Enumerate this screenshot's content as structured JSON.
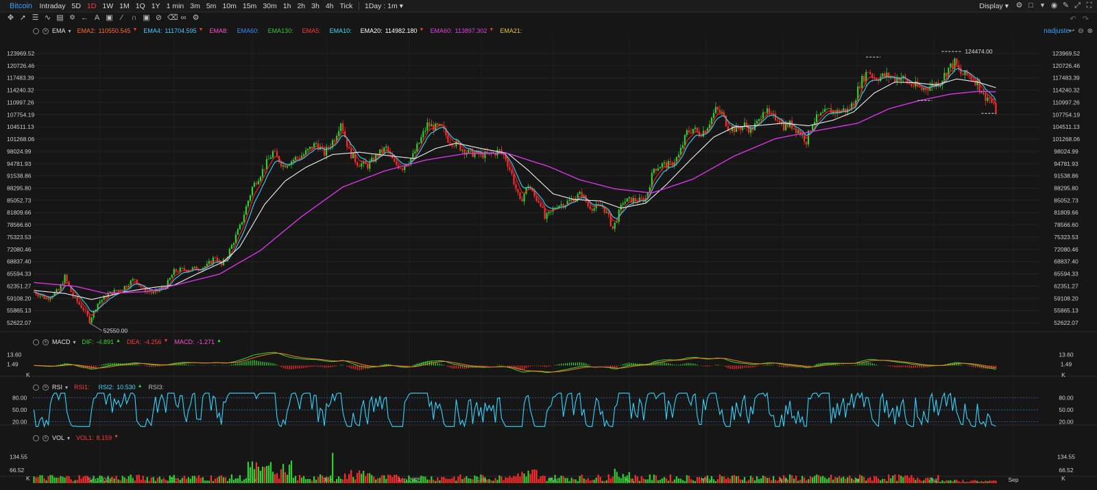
{
  "topbar": {
    "symbol": "Bitcoin",
    "timeframes": [
      "Intraday",
      "5D",
      "1D",
      "1W",
      "1M",
      "1Q",
      "1Y",
      "1 min",
      "3m",
      "5m",
      "10m",
      "15m",
      "30m",
      "1h",
      "2h",
      "3h",
      "4h",
      "Tick"
    ],
    "active_timeframe": "1D",
    "interval_select": "1Day : 1m",
    "display_label": "Display"
  },
  "main_legend": {
    "name": "EMA",
    "items": [
      {
        "label": "EMA2:",
        "value": "110550.545",
        "color": "#ff6a3a",
        "arrow": "down"
      },
      {
        "label": "EMA4:",
        "value": "111704.595",
        "color": "#46c8ff",
        "arrow": "down"
      },
      {
        "label": "EMA8:",
        "value": "",
        "color": "#ff4fcf",
        "arrow": ""
      },
      {
        "label": "EMA60:",
        "value": "",
        "color": "#3a8cff",
        "arrow": ""
      },
      {
        "label": "EMA130:",
        "value": "",
        "color": "#39c639",
        "arrow": ""
      },
      {
        "label": "EMA5:",
        "value": "",
        "color": "#ff3a3a",
        "arrow": ""
      },
      {
        "label": "EMA10:",
        "value": "",
        "color": "#46d8ff",
        "arrow": ""
      },
      {
        "label": "EMA20:",
        "value": "114982.180",
        "color": "#ffffff",
        "arrow": "down"
      },
      {
        "label": "EMA60:",
        "value": "113897.302",
        "color": "#e040e0",
        "arrow": "down"
      },
      {
        "label": "EMA21:",
        "value": "",
        "color": "#e5c542",
        "arrow": ""
      }
    ],
    "user": "nadjuste"
  },
  "macd_legend": {
    "name": "MACD",
    "items": [
      {
        "label": "DIF:",
        "value": "-4.891",
        "color": "#39d839",
        "arrow": "up"
      },
      {
        "label": "DEA:",
        "value": "-4.256",
        "color": "#ff3a3a",
        "arrow": "down"
      },
      {
        "label": "MACD:",
        "value": "-1.271",
        "color": "#ff4fcf",
        "arrow": "up"
      }
    ]
  },
  "rsi_legend": {
    "name": "RSI",
    "items": [
      {
        "label": "RSI1:",
        "value": "",
        "color": "#ff3a3a",
        "arrow": ""
      },
      {
        "label": "RSI2:",
        "value": "10.530",
        "color": "#46d8ff",
        "arrow": "up"
      },
      {
        "label": "RSI3:",
        "value": "",
        "color": "#bdbdbd",
        "arrow": ""
      }
    ]
  },
  "vol_legend": {
    "name": "VOL",
    "items": [
      {
        "label": "VOL1:",
        "value": "8.159",
        "color": "#ff3a3a",
        "arrow": "down"
      }
    ]
  },
  "chart_data": [
    {
      "type": "candlestick",
      "y_ticks": [
        "123969.52",
        "120726.46",
        "117483.39",
        "114240.32",
        "110997.26",
        "107754.19",
        "104511.13",
        "101268.06",
        "98024.99",
        "94781.93",
        "91538.86",
        "88295.80",
        "85052.73",
        "81809.66",
        "78566.60",
        "75323.53",
        "72080.46",
        "68837.40",
        "65594.33",
        "62351.27",
        "59108.20",
        "55865.13",
        "52622.07"
      ],
      "ylim": [
        51000,
        126500
      ],
      "x_ticks": [
        "Sep 2024",
        "Oct",
        "Nov",
        "Dec",
        "Jan 2025",
        "Feb",
        "Mar",
        "Apr",
        "May",
        "Jun",
        "Jul",
        "Aug",
        "Sep"
      ],
      "annotations": [
        "124474.00",
        "52550.00"
      ],
      "price_path": [
        [
          0,
          60800
        ],
        [
          6,
          59000
        ],
        [
          12,
          61200
        ],
        [
          15,
          64800
        ],
        [
          19,
          59500
        ],
        [
          24,
          56200
        ],
        [
          27,
          53200
        ],
        [
          31,
          57800
        ],
        [
          36,
          60200
        ],
        [
          43,
          61800
        ],
        [
          49,
          64300
        ],
        [
          53,
          61500
        ],
        [
          58,
          60400
        ],
        [
          64,
          62300
        ],
        [
          68,
          66200
        ],
        [
          73,
          66800
        ],
        [
          78,
          66900
        ],
        [
          84,
          67700
        ],
        [
          88,
          70200
        ],
        [
          91,
          67800
        ],
        [
          94,
          70600
        ],
        [
          100,
          78000
        ],
        [
          106,
          88500
        ],
        [
          111,
          93000
        ],
        [
          116,
          97800
        ],
        [
          121,
          94300
        ],
        [
          126,
          95900
        ],
        [
          131,
          97200
        ],
        [
          137,
          100200
        ],
        [
          141,
          97500
        ],
        [
          146,
          101600
        ],
        [
          149,
          106000
        ],
        [
          153,
          98000
        ],
        [
          157,
          95000
        ],
        [
          162,
          94200
        ],
        [
          167,
          97200
        ],
        [
          171,
          98900
        ],
        [
          175,
          94700
        ],
        [
          179,
          93800
        ],
        [
          184,
          96800
        ],
        [
          188,
          101500
        ],
        [
          191,
          105100
        ],
        [
          195,
          104300
        ],
        [
          198,
          104300
        ],
        [
          201,
          101300
        ],
        [
          205,
          99900
        ],
        [
          210,
          97800
        ],
        [
          215,
          97300
        ],
        [
          220,
          97000
        ],
        [
          226,
          98100
        ],
        [
          229,
          96300
        ],
        [
          232,
          91800
        ],
        [
          236,
          84500
        ],
        [
          240,
          89200
        ],
        [
          243,
          86000
        ],
        [
          246,
          84300
        ],
        [
          248,
          80200
        ],
        [
          251,
          81800
        ],
        [
          254,
          83800
        ],
        [
          258,
          84200
        ],
        [
          262,
          85700
        ],
        [
          266,
          86800
        ],
        [
          269,
          83700
        ],
        [
          272,
          83000
        ],
        [
          276,
          83600
        ],
        [
          279,
          80500
        ],
        [
          281,
          77500
        ],
        [
          283,
          80200
        ],
        [
          286,
          84700
        ],
        [
          290,
          85200
        ],
        [
          294,
          85000
        ],
        [
          297,
          85500
        ],
        [
          301,
          93500
        ],
        [
          305,
          94500
        ],
        [
          309,
          94400
        ],
        [
          313,
          96800
        ],
        [
          317,
          103000
        ],
        [
          320,
          104000
        ],
        [
          323,
          102700
        ],
        [
          326,
          103800
        ],
        [
          331,
          109000
        ],
        [
          334,
          108000
        ],
        [
          337,
          104500
        ],
        [
          341,
          103800
        ],
        [
          345,
          105000
        ],
        [
          348,
          103600
        ],
        [
          352,
          106000
        ],
        [
          354,
          109500
        ],
        [
          358,
          107000
        ],
        [
          361,
          107000
        ],
        [
          364,
          104700
        ],
        [
          367,
          105200
        ],
        [
          371,
          103500
        ],
        [
          375,
          100800
        ],
        [
          378,
          105900
        ],
        [
          382,
          107500
        ],
        [
          386,
          108800
        ],
        [
          390,
          108500
        ],
        [
          393,
          109000
        ],
        [
          395,
          108800
        ],
        [
          398,
          111000
        ],
        [
          401,
          116000
        ],
        [
          405,
          119500
        ],
        [
          408,
          117500
        ],
        [
          411,
          117800
        ],
        [
          414,
          118000
        ],
        [
          418,
          117500
        ],
        [
          421,
          117800
        ],
        [
          425,
          115800
        ],
        [
          428,
          115300
        ],
        [
          431,
          114500
        ],
        [
          435,
          115300
        ],
        [
          440,
          116500
        ],
        [
          444,
          120000
        ],
        [
          447,
          121500
        ],
        [
          450,
          118500
        ],
        [
          454,
          118000
        ],
        [
          458,
          116400
        ],
        [
          461,
          112800
        ],
        [
          464,
          112000
        ],
        [
          467,
          108600
        ]
      ],
      "ema20_path": [
        [
          0,
          61200
        ],
        [
          15,
          60400
        ],
        [
          28,
          58800
        ],
        [
          45,
          60900
        ],
        [
          58,
          62000
        ],
        [
          68,
          62600
        ],
        [
          80,
          65800
        ],
        [
          92,
          68800
        ],
        [
          100,
          72800
        ],
        [
          112,
          84000
        ],
        [
          122,
          90200
        ],
        [
          132,
          93800
        ],
        [
          145,
          97200
        ],
        [
          158,
          97800
        ],
        [
          172,
          96900
        ],
        [
          185,
          96100
        ],
        [
          195,
          98800
        ],
        [
          205,
          100200
        ],
        [
          218,
          98700
        ],
        [
          230,
          97500
        ],
        [
          240,
          93000
        ],
        [
          252,
          86800
        ],
        [
          262,
          85300
        ],
        [
          275,
          84900
        ],
        [
          285,
          83000
        ],
        [
          297,
          84300
        ],
        [
          307,
          89200
        ],
        [
          318,
          95400
        ],
        [
          330,
          101800
        ],
        [
          340,
          104500
        ],
        [
          352,
          104900
        ],
        [
          364,
          105500
        ],
        [
          376,
          104800
        ],
        [
          388,
          106300
        ],
        [
          398,
          108500
        ],
        [
          408,
          113500
        ],
        [
          418,
          116400
        ],
        [
          428,
          116200
        ],
        [
          438,
          115600
        ],
        [
          448,
          117200
        ],
        [
          458,
          116400
        ],
        [
          467,
          114900
        ]
      ],
      "ema60_path": [
        [
          0,
          63300
        ],
        [
          20,
          62300
        ],
        [
          35,
          60400
        ],
        [
          55,
          60900
        ],
        [
          70,
          62800
        ],
        [
          90,
          65500
        ],
        [
          110,
          71800
        ],
        [
          130,
          80800
        ],
        [
          150,
          88600
        ],
        [
          170,
          92800
        ],
        [
          190,
          95700
        ],
        [
          210,
          97500
        ],
        [
          230,
          97500
        ],
        [
          250,
          94000
        ],
        [
          265,
          90500
        ],
        [
          282,
          88100
        ],
        [
          300,
          87000
        ],
        [
          320,
          90700
        ],
        [
          340,
          96800
        ],
        [
          360,
          101400
        ],
        [
          380,
          103500
        ],
        [
          400,
          105500
        ],
        [
          415,
          109300
        ],
        [
          430,
          111500
        ],
        [
          445,
          113200
        ],
        [
          458,
          113900
        ],
        [
          467,
          113800
        ]
      ]
    },
    {
      "type": "line",
      "name": "MACD",
      "y_ticks": [
        "13.60",
        "1.49",
        "K"
      ],
      "ylim": [
        -10,
        20
      ]
    },
    {
      "type": "line",
      "name": "RSI",
      "y_ticks": [
        "80.00",
        "50.00",
        "20.00"
      ],
      "ylim": [
        5,
        95
      ]
    },
    {
      "type": "bar",
      "name": "VOL",
      "y_ticks": [
        "134.55",
        "66.52",
        "K"
      ],
      "ylim": [
        0,
        175
      ]
    }
  ]
}
